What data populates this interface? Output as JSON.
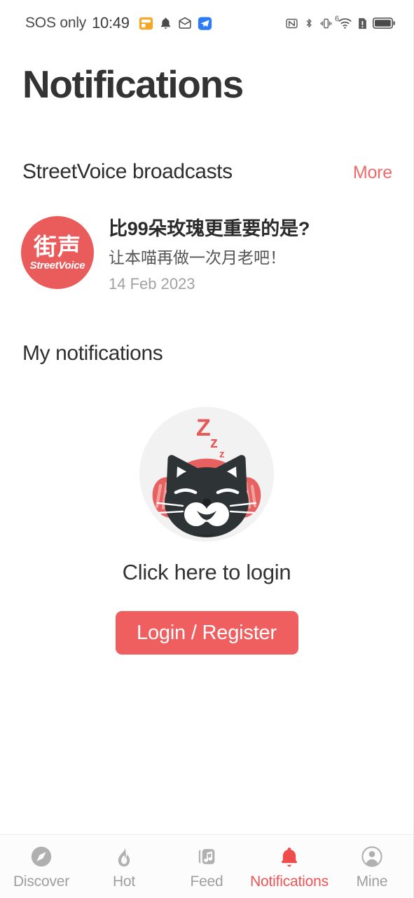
{
  "theme": {
    "accent": "#ef5f60",
    "accent_active": "#ef5555",
    "logo_red": "#ea5c5c",
    "text_dark": "#333333",
    "text_muted": "#9e9e9e",
    "background": "#ffffff"
  },
  "status_bar": {
    "carrier": "SOS only",
    "time": "10:49",
    "left_icons": [
      {
        "name": "calendar-app-icon",
        "glyph": "calendar"
      },
      {
        "name": "bell-notification-icon",
        "glyph": "bell"
      },
      {
        "name": "mail-envelope-icon",
        "glyph": "envelope"
      },
      {
        "name": "messenger-app-icon",
        "glyph": "paper-plane"
      }
    ],
    "right_icons": [
      {
        "name": "nfc-icon",
        "glyph": "nfc"
      },
      {
        "name": "bluetooth-icon",
        "glyph": "bluetooth"
      },
      {
        "name": "vibrate-mode-icon",
        "glyph": "vibrate"
      },
      {
        "name": "wifi-icon",
        "glyph": "wifi",
        "badge": "6"
      },
      {
        "name": "sim-alert-icon",
        "glyph": "sim-alert"
      },
      {
        "name": "battery-icon",
        "glyph": "battery-full"
      }
    ]
  },
  "header": {
    "title": "Notifications"
  },
  "broadcasts_section": {
    "title": "StreetVoice broadcasts",
    "more_label": "More",
    "item": {
      "logo_cn": "街声",
      "logo_en": "StreetVoice",
      "title": "比99朵玫瑰更重要的是?",
      "subtitle": "让本喵再做一次月老吧！",
      "date": "14 Feb 2023"
    }
  },
  "my_notifications_section": {
    "title": "My notifications",
    "empty_state": {
      "illustration_name": "sleeping-cat-illustration",
      "sleep_letters": [
        "Z",
        "z",
        "z"
      ],
      "message": "Click here to login",
      "button_label": "Login / Register"
    }
  },
  "bottom_nav": {
    "items": [
      {
        "label": "Discover",
        "icon": "compass-icon",
        "active": false
      },
      {
        "label": "Hot",
        "icon": "flame-icon",
        "active": false
      },
      {
        "label": "Feed",
        "icon": "music-card-icon",
        "active": false
      },
      {
        "label": "Notifications",
        "icon": "bell-icon",
        "active": true
      },
      {
        "label": "Mine",
        "icon": "user-circle-icon",
        "active": false
      }
    ]
  }
}
